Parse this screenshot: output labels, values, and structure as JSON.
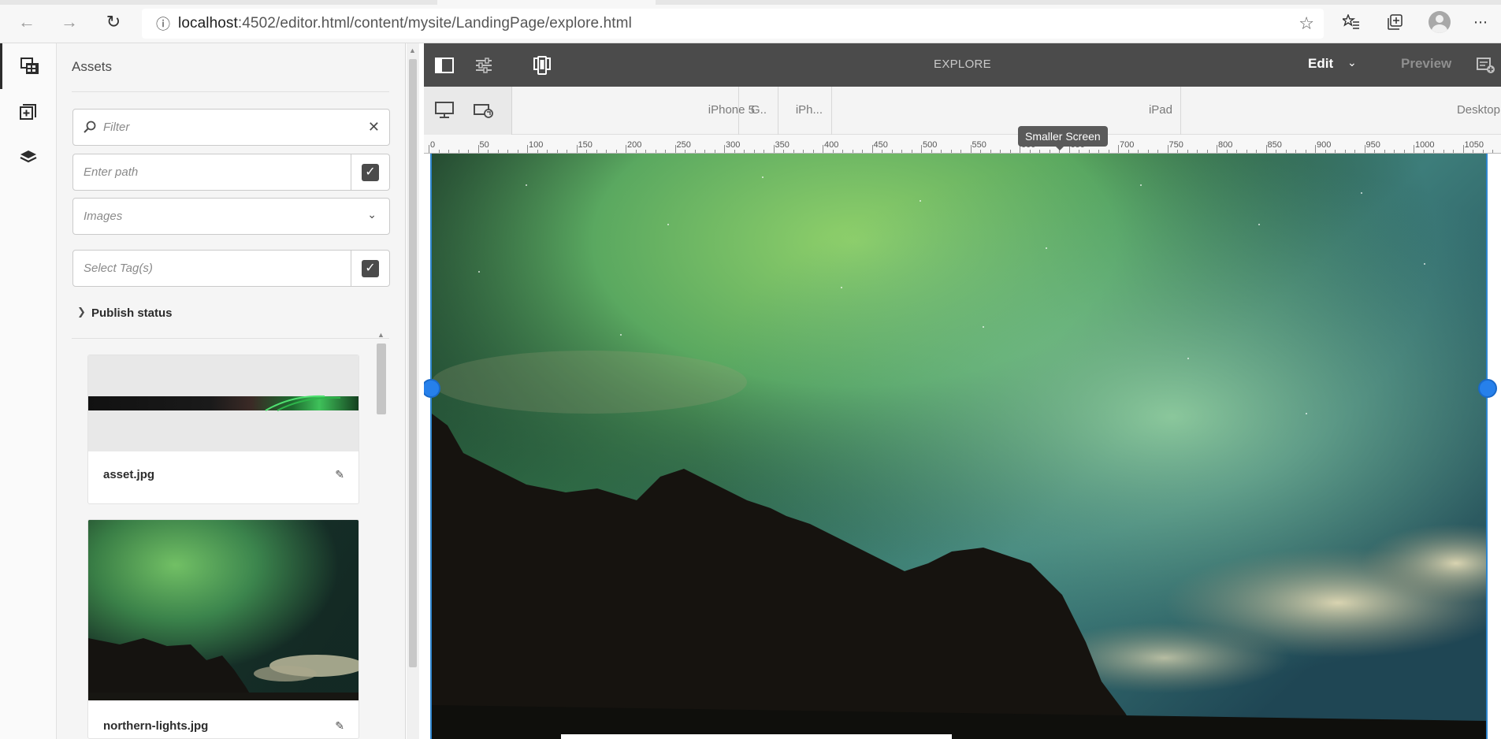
{
  "browser": {
    "url_host": "localhost",
    "url_rest": ":4502/editor.html/content/mysite/LandingPage/explore.html"
  },
  "panel": {
    "title": "Assets",
    "filter_placeholder": "Filter",
    "path_placeholder": "Enter path",
    "type_value": "Images",
    "tags_placeholder": "Select Tag(s)",
    "publish_status": "Publish status",
    "assets": [
      {
        "name": "asset.jpg"
      },
      {
        "name": "northern-lights.jpg"
      }
    ]
  },
  "editor": {
    "page_name": "EXPLORE",
    "mode": "Edit",
    "preview": "Preview",
    "tooltip": "Smaller Screen",
    "devices": [
      "iPhone 5",
      "G..",
      "iPh...",
      "iPad",
      "Desktop"
    ],
    "ruler_labels": [
      "0",
      "50",
      "100",
      "150",
      "200",
      "250",
      "300",
      "350",
      "400",
      "450",
      "500",
      "550",
      "600",
      "650",
      "700",
      "750",
      "800",
      "850",
      "900",
      "950",
      "1000",
      "1050"
    ]
  },
  "colors": {
    "editor_bar": "#4b4b4b",
    "accent_blue": "#2680eb"
  }
}
